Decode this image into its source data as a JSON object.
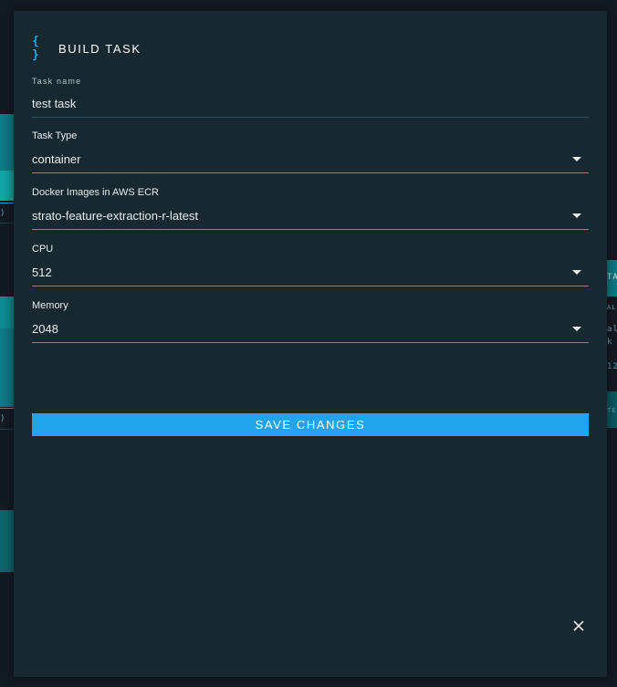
{
  "modal": {
    "icon": "braces-icon",
    "title": "BUILD TASK",
    "close_icon": "close-icon"
  },
  "fields": {
    "task_name": {
      "label": "Task name",
      "value": "test task"
    },
    "task_type": {
      "label": "Task Type",
      "value": "container"
    },
    "docker_image": {
      "label": "Docker Images in AWS ECR",
      "value": "strato-feature-extraction-r-latest"
    },
    "cpu": {
      "label": "CPU",
      "value": "512"
    },
    "memory": {
      "label": "Memory",
      "value": "2048"
    }
  },
  "actions": {
    "save_label": "SAVE CHANGES"
  },
  "background": {
    "right_fragments": [
      "TA",
      "AL",
      "al",
      "k",
      "12",
      "TE"
    ],
    "left_fragments": [
      ")",
      ")"
    ]
  },
  "colors": {
    "accent": "#22a4ec",
    "modal_bg": "#172830",
    "page_bg": "#131b22",
    "teal": "#11a8a8"
  }
}
